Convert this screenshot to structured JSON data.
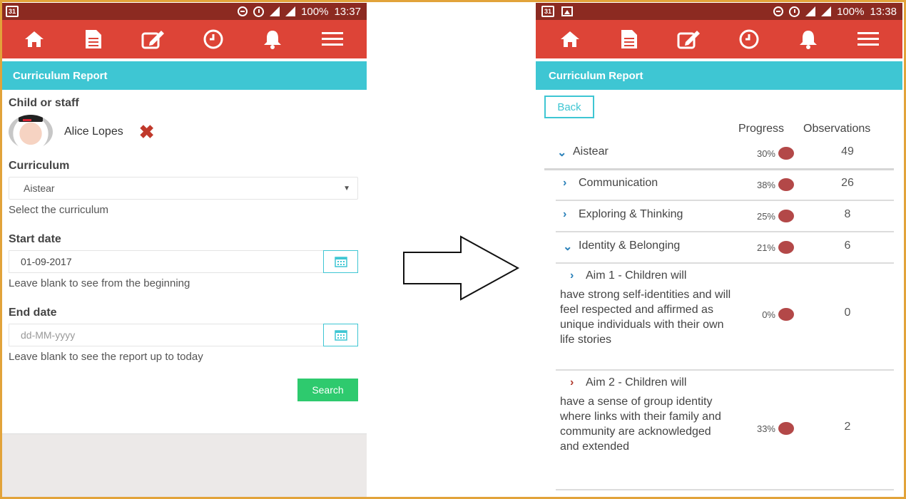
{
  "left_screen": {
    "status": {
      "battery": "100%",
      "time": "13:37",
      "calendar_day": "31"
    },
    "header_title": "Curriculum Report",
    "child_label": "Child or staff",
    "child_name": "Alice Lopes",
    "curriculum_label": "Curriculum",
    "curriculum_value": "Aistear",
    "curriculum_help": "Select the curriculum",
    "start_label": "Start date",
    "start_value": "01-09-2017",
    "start_help": "Leave blank to see from the beginning",
    "end_label": "End date",
    "end_placeholder": "dd-MM-yyyy",
    "end_help": "Leave blank to see the report up to today",
    "search_label": "Search"
  },
  "right_screen": {
    "status": {
      "battery": "100%",
      "time": "13:38",
      "calendar_day": "31"
    },
    "header_title": "Curriculum Report",
    "back_label": "Back",
    "col_progress": "Progress",
    "col_observations": "Observations",
    "rows": [
      {
        "name": "Aistear",
        "progress": "30%",
        "observations": "49",
        "expanded": true
      },
      {
        "name": "Communication",
        "progress": "38%",
        "observations": "26",
        "expanded": false
      },
      {
        "name": "Exploring & Thinking",
        "progress": "25%",
        "observations": "8",
        "expanded": false
      },
      {
        "name": "Identity & Belonging",
        "progress": "21%",
        "observations": "6",
        "expanded": true
      },
      {
        "name": "Aim 1 - Children will",
        "rest": "have strong self-identities and will feel respected and affirmed as unique individuals with their own life stories",
        "progress": "0%",
        "observations": "0"
      },
      {
        "name": "Aim 2 - Children will",
        "rest": "have a sense of group identity where links with their family and community are acknowledged and extended",
        "progress": "33%",
        "observations": "2"
      }
    ]
  },
  "colors": {
    "status_bar": "#8c2a21",
    "nav_bar": "#dd4437",
    "header": "#3ec6d3",
    "search_button": "#2eca6e",
    "progress_dot": "#b34848",
    "frame": "#e2a33a"
  },
  "icons": [
    "home-icon",
    "document-icon",
    "edit-icon",
    "clock-icon",
    "bell-icon",
    "menu-icon"
  ]
}
